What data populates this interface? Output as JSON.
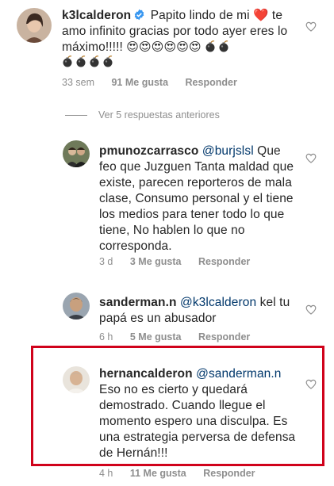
{
  "comments": [
    {
      "username": "k3lcalderon",
      "verified": true,
      "text_before": "Papito lindo de mi ",
      "heart_emoji": "❤️",
      "text_after": " te amo infinito gracias por todo ayer eres lo máximo!!!!! ",
      "emojis": "😍😍😍😍😍😍",
      "bomb_icon": "bomb-emoji",
      "time": "33 sem",
      "likes": "91 Me gusta",
      "reply": "Responder"
    },
    {
      "username": "pmunozcarrasco",
      "mention": "@burjslsl",
      "text": "Que feo que Juzguen Tanta maldad que existe, parecen reporteros de mala clase, Consumo personal y el tiene los medios para tener todo lo que tiene, No hablen lo que no corresponda.",
      "time": "3 d",
      "likes": "3 Me gusta",
      "reply": "Responder"
    },
    {
      "username": "sanderman.n",
      "mention": "@k3lcalderon",
      "text": "kel tu papá es un abusador",
      "time": "6 h",
      "likes": "5 Me gusta",
      "reply": "Responder"
    },
    {
      "username": "hernancalderon",
      "mention": "@sanderman.n",
      "text": "Eso no es cierto y quedará demostrado. Cuando llegue el momento espero una disculpa. Es una estrategia perversa de defensa de Hernán!!!",
      "time": "4 h",
      "likes": "11 Me gusta",
      "reply": "Responder"
    }
  ],
  "view_replies": "Ver 5 respuestas anteriores",
  "colors": {
    "text": "#262626",
    "meta": "#8e8e8e",
    "mention": "#00376b",
    "verified": "#3897f0",
    "highlight": "#d0021b"
  }
}
